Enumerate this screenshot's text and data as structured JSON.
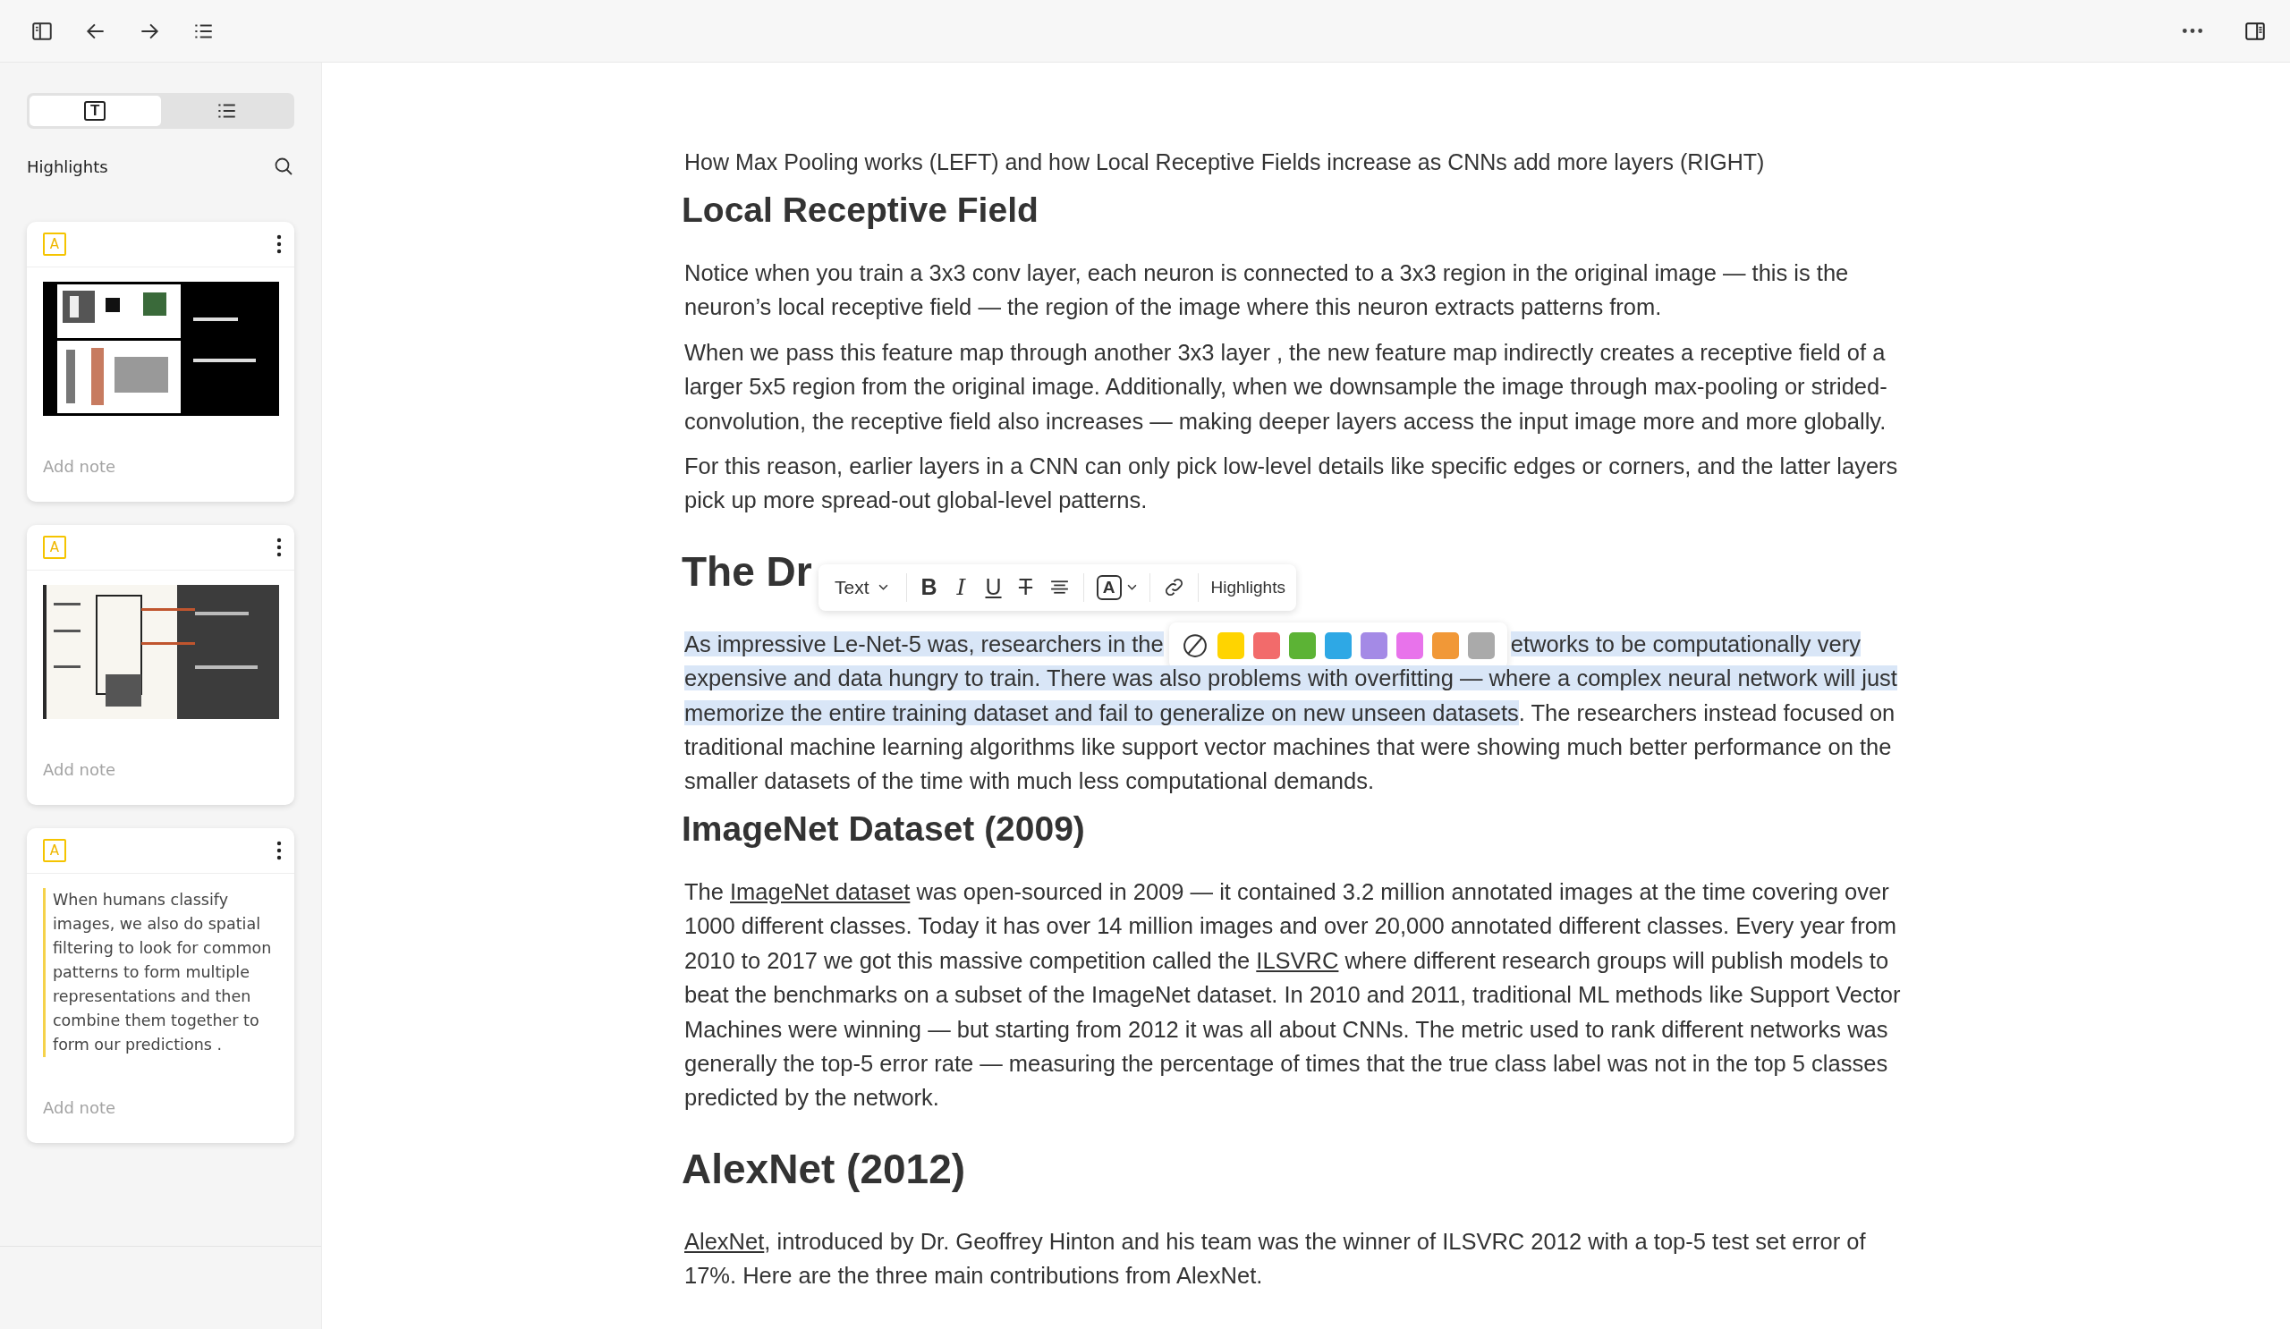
{
  "sidebar": {
    "tabs": [
      {
        "kind": "text",
        "label": "T",
        "selected": true
      },
      {
        "kind": "list",
        "selected": false
      }
    ],
    "title": "Highlights",
    "cards": [
      {
        "badge": "A",
        "kind": "picture",
        "placeholder": "Add note"
      },
      {
        "badge": "A",
        "kind": "picture",
        "placeholder": "Add note"
      },
      {
        "badge": "A",
        "kind": "quote",
        "text": "When humans classify images, we also do spatial filtering to look for common patterns to form multiple representations and then combine them together to form our predictions .",
        "placeholder": "Add note"
      }
    ]
  },
  "document": {
    "blocks": [
      {
        "kind": "caption",
        "text": "How Max Pooling works (LEFT) and how Local Receptive Fields increase as CNNs add more layers (RIGHT)"
      },
      {
        "kind": "h2",
        "text": "Local Receptive Field"
      },
      {
        "kind": "p",
        "parts": [
          {
            "kind": "text",
            "text": "Notice when you train a 3x3 conv layer, each neuron is connected to a 3x3 region in the original image — this is the neuron’s local receptive field — the region of the image where this neuron extracts patterns from."
          }
        ]
      },
      {
        "kind": "p",
        "parts": [
          {
            "kind": "text",
            "text": "When we pass this feature map through another 3x3 layer , the new feature map indirectly creates a receptive field of a larger 5x5 region from the original image. Additionally, when we downsample the image through max-pooling or strided-convolution, the receptive field also increases — making deeper layers access the input image more and more globally."
          }
        ]
      },
      {
        "kind": "p",
        "parts": [
          {
            "kind": "text",
            "text": "For this reason, earlier layers in a CNN can only pick low-level details like specific edges or corners, and the latter layers pick up more spread-out global-level patterns."
          }
        ]
      },
      {
        "kind": "h1",
        "text": "The Dr",
        "toolbar": true
      },
      {
        "kind": "sel",
        "parts": [
          {
            "kind": "text",
            "text": "As impressive Le-Net-5 was, researchers in the",
            "selected": true
          },
          {
            "kind": "palette"
          },
          {
            "kind": "text",
            "text": "etworks to be computationally very expensive and data hungry to train. There was also problems with overfitting — where a complex neural network will just memorize the entire training dataset and fail to generalize on new unseen datasets",
            "selected": true
          },
          {
            "kind": "text",
            "text": ". The researchers instead focused on traditional machine learning algorithms like support vector machines that were showing much better performance on the smaller datasets of the time with much less computational demands.",
            "selected": false
          }
        ]
      },
      {
        "kind": "h2",
        "text": "ImageNet Dataset (2009)"
      },
      {
        "kind": "p",
        "parts": [
          {
            "kind": "text",
            "text": "The "
          },
          {
            "kind": "link",
            "text": "ImageNet dataset"
          },
          {
            "kind": "text",
            "text": " was open-sourced in 2009 — it contained 3.2 million annotated images at the time covering over 1000 different classes. Today it has over 14 million images and over 20,000 annotated different classes. Every year from 2010 to 2017 we got this massive competition called the "
          },
          {
            "kind": "link",
            "text": "ILSVRC"
          },
          {
            "kind": "text",
            "text": " where different research groups will publish models to beat the benchmarks on a subset of the ImageNet dataset. In 2010 and 2011, traditional ML methods like Support Vector Machines were winning — but starting from 2012 it was all about CNNs. The metric used to rank different networks was generally the top-5 error rate — measuring the percentage of times that the true class label was not in the top 5 classes predicted by the network."
          }
        ]
      },
      {
        "kind": "h1",
        "text": "AlexNet (2012)",
        "toolbar": false
      },
      {
        "kind": "p",
        "parts": [
          {
            "kind": "link",
            "text": "AlexNet"
          },
          {
            "kind": "text",
            "text": ", introduced by Dr. Geoffrey Hinton and his team was the winner of ILSVRC 2012 with a top-5 test set error of 17%. Here are the three main contributions from AlexNet."
          }
        ]
      }
    ]
  },
  "format_toolbar": {
    "block_type": "Text",
    "buttons": [
      {
        "kind": "bold",
        "label": "B"
      },
      {
        "kind": "italic",
        "label": "I"
      },
      {
        "kind": "underline",
        "label": "U"
      },
      {
        "kind": "strike",
        "label": "T"
      },
      {
        "kind": "align"
      }
    ],
    "font_color_label": "A",
    "highlights_label": "Highlights"
  },
  "highlight_palette": {
    "colors": [
      {
        "kind": "clear"
      },
      {
        "kind": "swatch",
        "color": "#ffd400"
      },
      {
        "kind": "swatch",
        "color": "#f26b6b"
      },
      {
        "kind": "swatch",
        "color": "#5cb335"
      },
      {
        "kind": "swatch",
        "color": "#2ea8e5"
      },
      {
        "kind": "swatch",
        "color": "#a48ae6"
      },
      {
        "kind": "swatch",
        "color": "#e873eb"
      },
      {
        "kind": "swatch",
        "color": "#f19837"
      },
      {
        "kind": "swatch",
        "color": "#aaaaaa"
      }
    ]
  }
}
